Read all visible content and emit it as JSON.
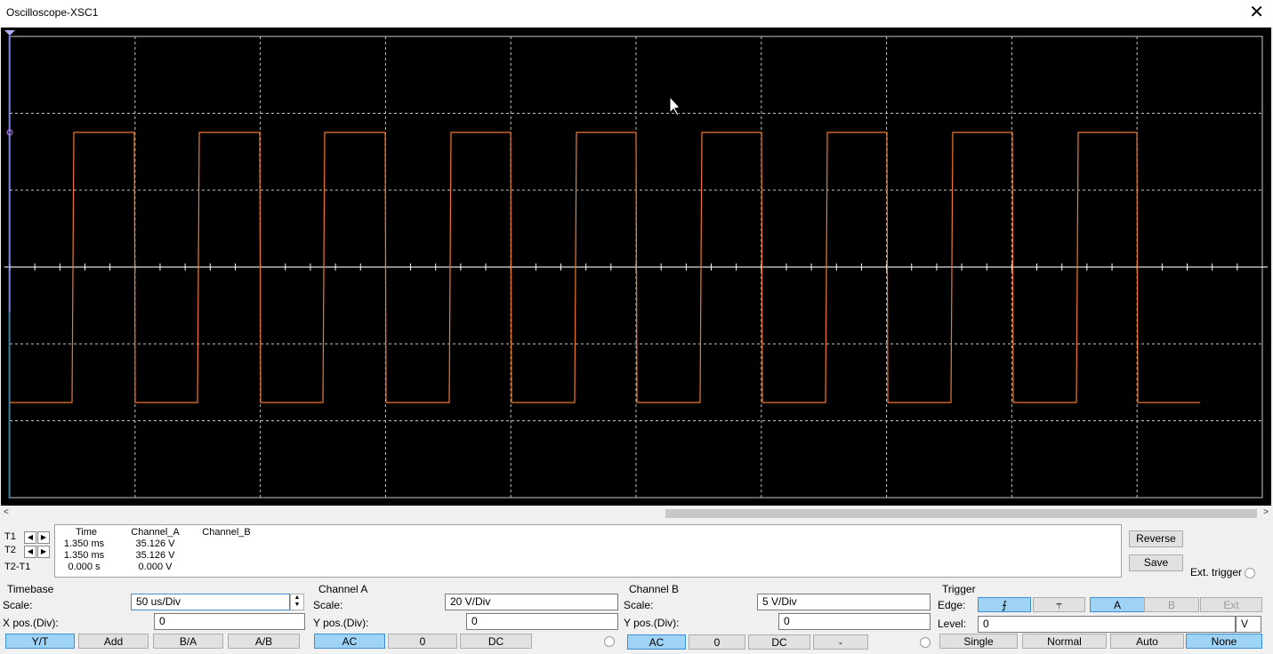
{
  "window": {
    "title": "Oscilloscope-XSC1",
    "close": "✕"
  },
  "colors": {
    "screen_bg": "#000000",
    "grid": "#c8c8c8",
    "trace": "#f07830",
    "axis": "#ffffff",
    "selected": "#9fd3f5"
  },
  "scrollbar": {
    "left": "<",
    "right": ">"
  },
  "readout": {
    "headers": {
      "time": "Time",
      "a": "Channel_A",
      "b": "Channel_B"
    },
    "rows": [
      {
        "label": "T1",
        "time": "1.350 ms",
        "a": "35.126 V"
      },
      {
        "label": "T2",
        "time": "1.350 ms",
        "a": "35.126 V"
      },
      {
        "label": "T2-T1",
        "time": "0.000 s",
        "a": "0.000 V"
      }
    ],
    "reverse": "Reverse",
    "save": "Save",
    "ext_trigger": "Ext. trigger"
  },
  "timebase": {
    "title": "Timebase",
    "scale_label": "Scale:",
    "scale": "50 us/Div",
    "xpos_label": "X pos.(Div):",
    "xpos": "0",
    "buttons": [
      "Y/T",
      "Add",
      "B/A",
      "A/B"
    ],
    "selected": "Y/T"
  },
  "channel_a": {
    "title": "Channel A",
    "scale_label": "Scale:",
    "scale": "20  V/Div",
    "ypos_label": "Y pos.(Div):",
    "ypos": "0",
    "buttons": [
      "AC",
      "0",
      "DC"
    ],
    "selected": "AC"
  },
  "channel_b": {
    "title": "Channel B",
    "scale_label": "Scale:",
    "scale": "5  V/Div",
    "ypos_label": "Y pos.(Div):",
    "ypos": "0",
    "buttons": [
      "AC",
      "0",
      "DC",
      "-"
    ],
    "selected": "AC"
  },
  "trigger": {
    "title": "Trigger",
    "edge_label": "Edge:",
    "edge_rising": "⨍",
    "edge_falling": "⥾",
    "sources": [
      "A",
      "B",
      "Ext"
    ],
    "source_selected": "A",
    "level_label": "Level:",
    "level": "0",
    "level_unit": "V",
    "modes": [
      "Single",
      "Normal",
      "Auto",
      "None"
    ],
    "mode_selected": "None"
  }
}
